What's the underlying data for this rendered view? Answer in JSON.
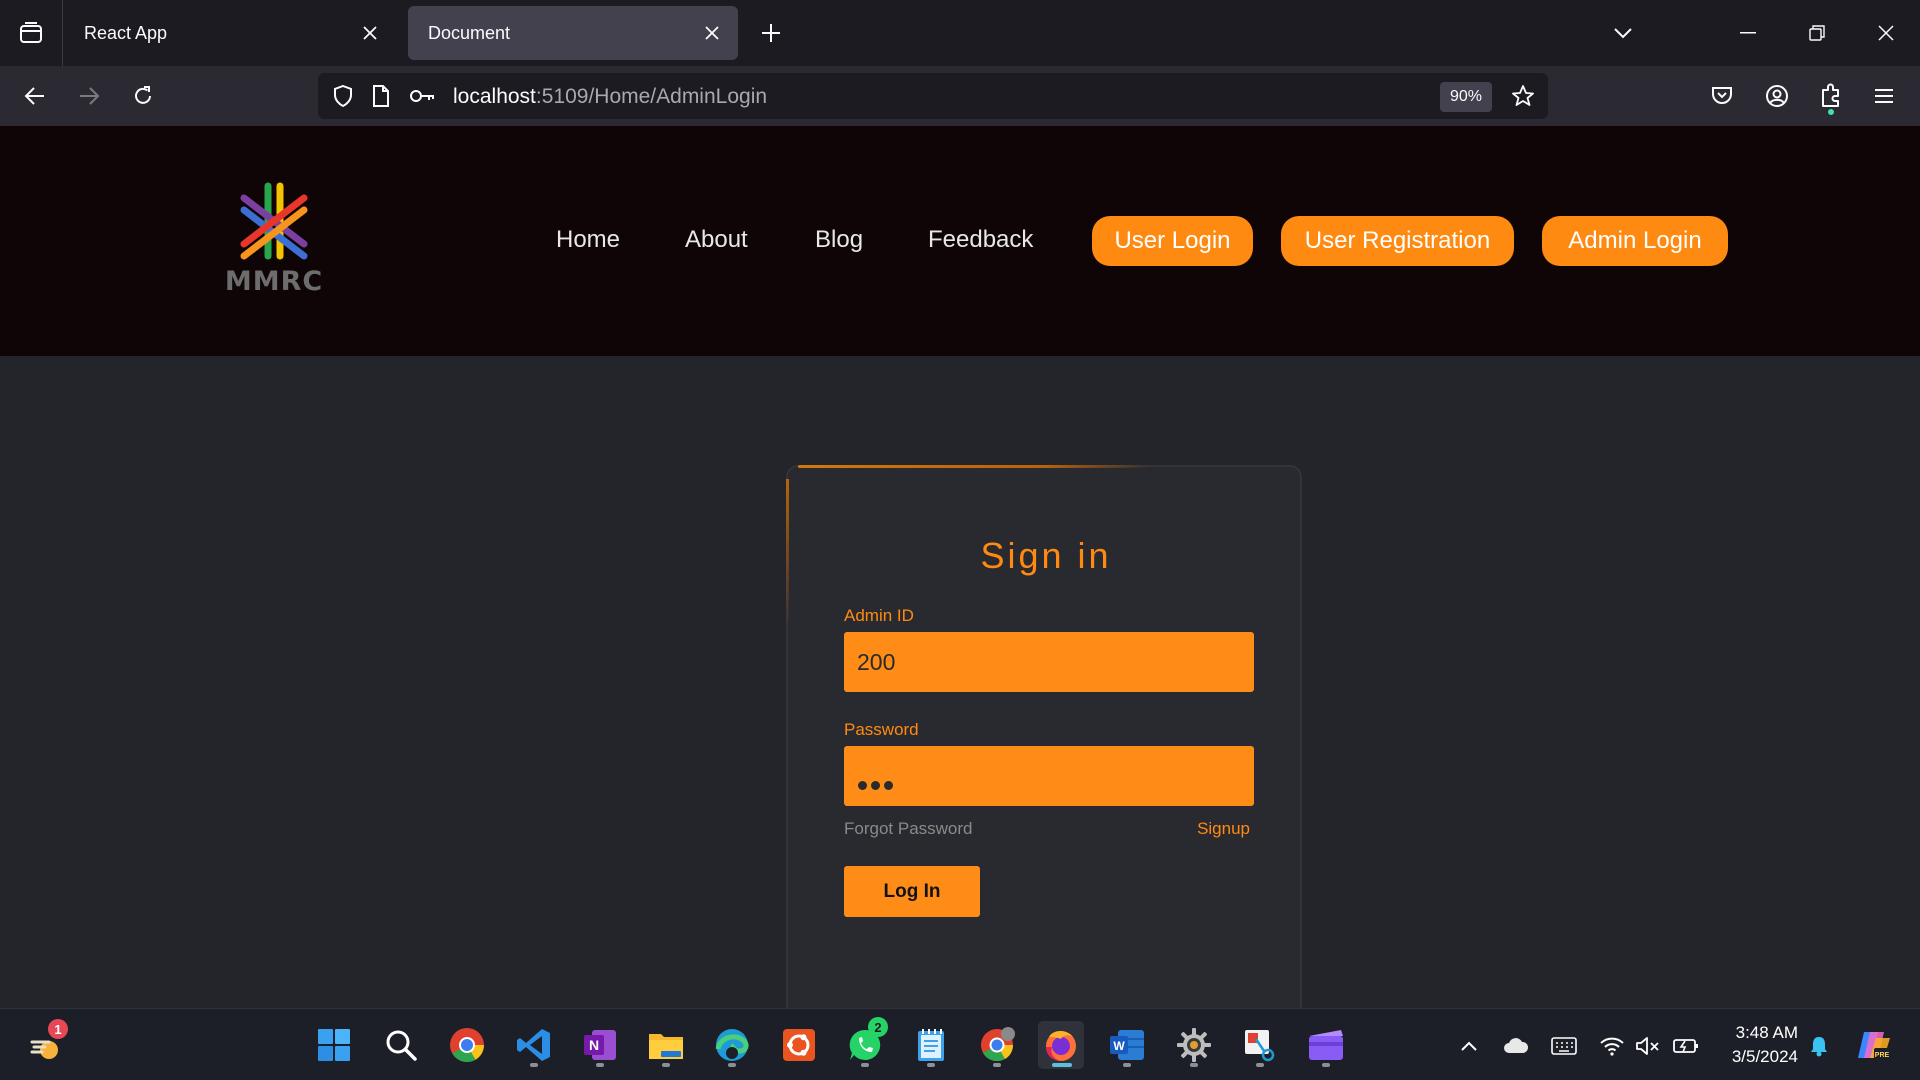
{
  "browser": {
    "tabs": [
      {
        "title": "React App"
      },
      {
        "title": "Document"
      }
    ],
    "url": {
      "host": "localhost",
      "rest": ":5109/Home/AdminLogin"
    },
    "zoom": "90%"
  },
  "site": {
    "logo_text": "MMRC",
    "nav": {
      "home": "Home",
      "about": "About",
      "blog": "Blog",
      "feedback": "Feedback",
      "user_login": "User Login",
      "user_registration": "User Registration",
      "admin_login": "Admin Login"
    }
  },
  "login": {
    "title": "Sign in",
    "admin_id_label": "Admin ID",
    "admin_id_value": "200",
    "password_label": "Password",
    "forgot_password": "Forgot Password",
    "signup": "Signup",
    "login_button": "Log In"
  },
  "taskbar": {
    "widget_badge": "1",
    "whatsapp_badge": "2",
    "time": "3:48 AM",
    "date": "3/5/2024"
  },
  "colors": {
    "accent": "#ff8a12",
    "header_bg": "#0f0506",
    "page_bg": "#23252b",
    "card_bg": "#292a2f"
  }
}
